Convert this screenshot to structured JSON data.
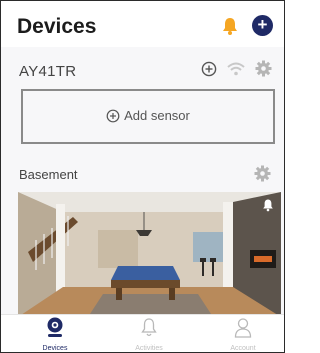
{
  "header": {
    "title": "Devices"
  },
  "hub": {
    "name": "AY41TR"
  },
  "add_sensor": {
    "label": "Add sensor"
  },
  "section": {
    "title": "Basement"
  },
  "tabs": [
    {
      "label": "Devices"
    },
    {
      "label": "Activities"
    },
    {
      "label": "Account"
    }
  ],
  "colors": {
    "accent": "#1f2a66",
    "alert": "#f5a623"
  },
  "icons": [
    "bell-icon",
    "plus-icon",
    "add-circle-icon",
    "wifi-icon",
    "gear-icon",
    "camera-pin-icon",
    "bell-outline-icon",
    "user-icon"
  ]
}
